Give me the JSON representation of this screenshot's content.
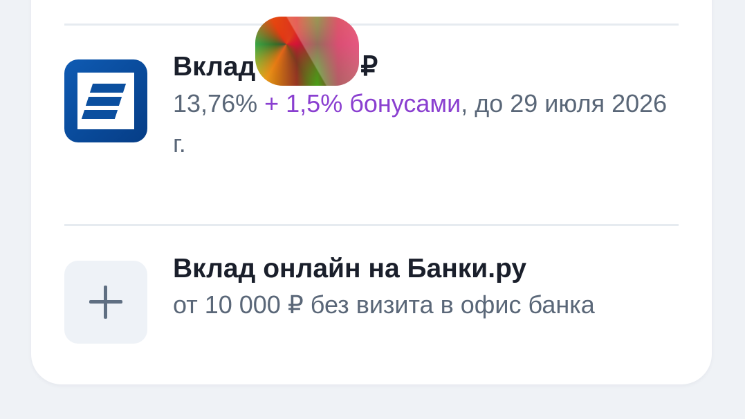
{
  "deposit": {
    "title_prefix": "Вклад",
    "title_suffix": "₽",
    "rate": "13,76%",
    "bonus": "+ 1,5% бонусами",
    "term": ", до 29 июля 2026 г.",
    "logo_icon": "bank-logo-icon",
    "colors": {
      "logo_bg": "#094a9a",
      "bonus_text": "#8a3fd0"
    }
  },
  "online_deposit": {
    "title": "Вклад онлайн на Банки.ру",
    "subtitle": "от 10 000 ₽ без визита в офис банка",
    "icon": "plus-icon"
  }
}
